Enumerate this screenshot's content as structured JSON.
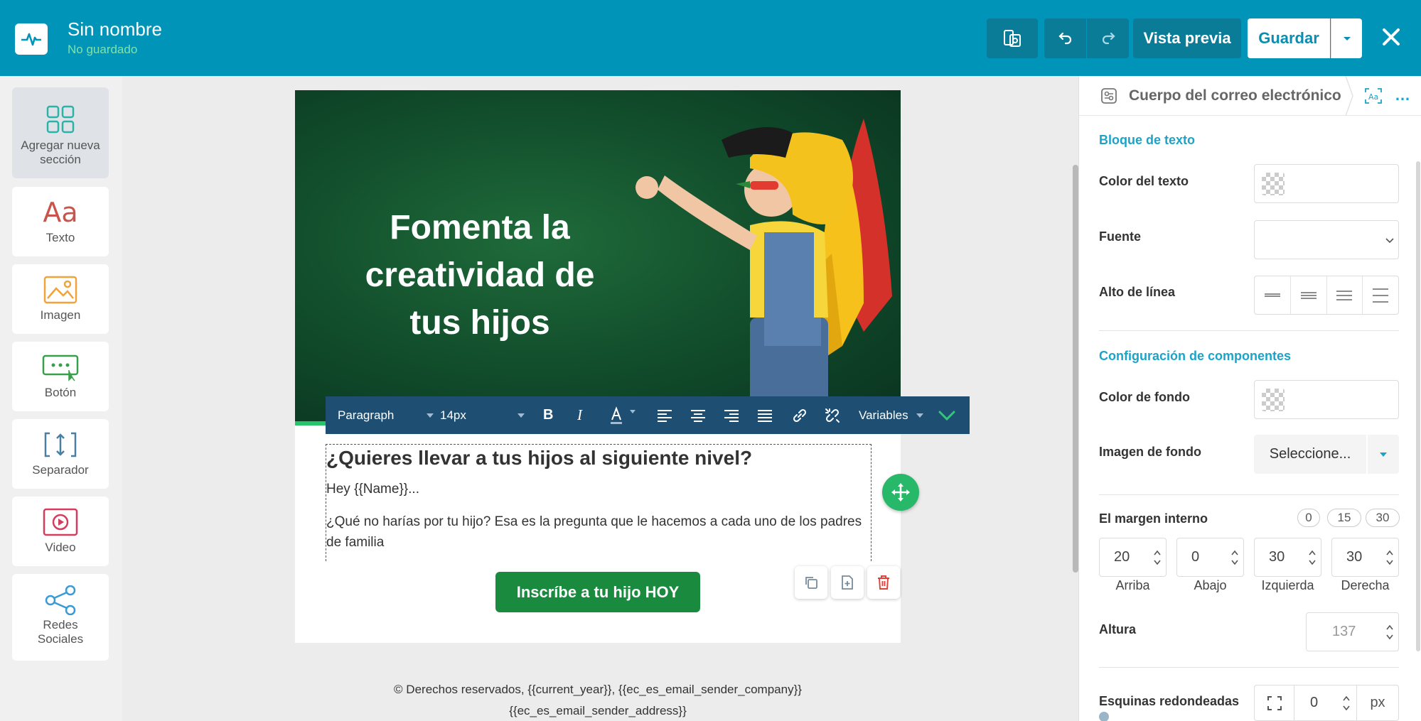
{
  "header": {
    "title": "Sin nombre",
    "subtitle": "No guardado",
    "preview_label": "Vista previa",
    "save_label": "Guardar"
  },
  "sidebar": {
    "items": [
      {
        "label": "Agregar nueva sección",
        "icon": "grid-icon"
      },
      {
        "label": "Texto",
        "icon": "text-icon"
      },
      {
        "label": "Imagen",
        "icon": "image-icon"
      },
      {
        "label": "Botón",
        "icon": "button-icon"
      },
      {
        "label": "Separador",
        "icon": "separator-icon"
      },
      {
        "label": "Video",
        "icon": "video-icon"
      },
      {
        "label": "Redes Sociales",
        "icon": "share-icon"
      }
    ]
  },
  "canvas": {
    "hero_title": "Fomenta la creatividad de tus hijos",
    "heading": "¿Quieres llevar a tus hijos al siguiente nivel?",
    "greeting": "Hey {{Name}}...",
    "body": "¿Qué no harías por tu hijo? Esa es la pregunta que le hacemos a cada uno de los padres de familia",
    "cta_label": "Inscríbe a tu hijo HOY",
    "footer_line1": "© Derechos reservados, {{current_year}}, {{ec_es_email_sender_company}}",
    "footer_line2": "{{ec_es_email_sender_address}}"
  },
  "toolbar": {
    "format": "Paragraph",
    "font_size": "14px",
    "variables_label": "Variables"
  },
  "panel": {
    "title": "Cuerpo del correo electrónico",
    "text_block_section": "Bloque de texto",
    "text_color_label": "Color del texto",
    "font_label": "Fuente",
    "line_height_label": "Alto de línea",
    "component_section": "Configuración de componentes",
    "bg_color_label": "Color de fondo",
    "bg_image_label": "Imagen de fondo",
    "bg_image_select": "Seleccione...",
    "padding_label": "El margen interno",
    "padding_presets": [
      "0",
      "15",
      "30"
    ],
    "padding_values": [
      {
        "value": "20",
        "caption": "Arriba"
      },
      {
        "value": "0",
        "caption": "Abajo"
      },
      {
        "value": "30",
        "caption": "Izquierda"
      },
      {
        "value": "30",
        "caption": "Derecha"
      }
    ],
    "height_label": "Altura",
    "height_value": "137",
    "radius_label": "Esquinas redondeadas",
    "radius_value": "0",
    "radius_unit": "px"
  },
  "colors": {
    "header_bg": "#0095b8",
    "accent": "#1ba4c8",
    "cta_bg": "#1a8a3f",
    "toolbar_bg": "#1e4e72"
  }
}
